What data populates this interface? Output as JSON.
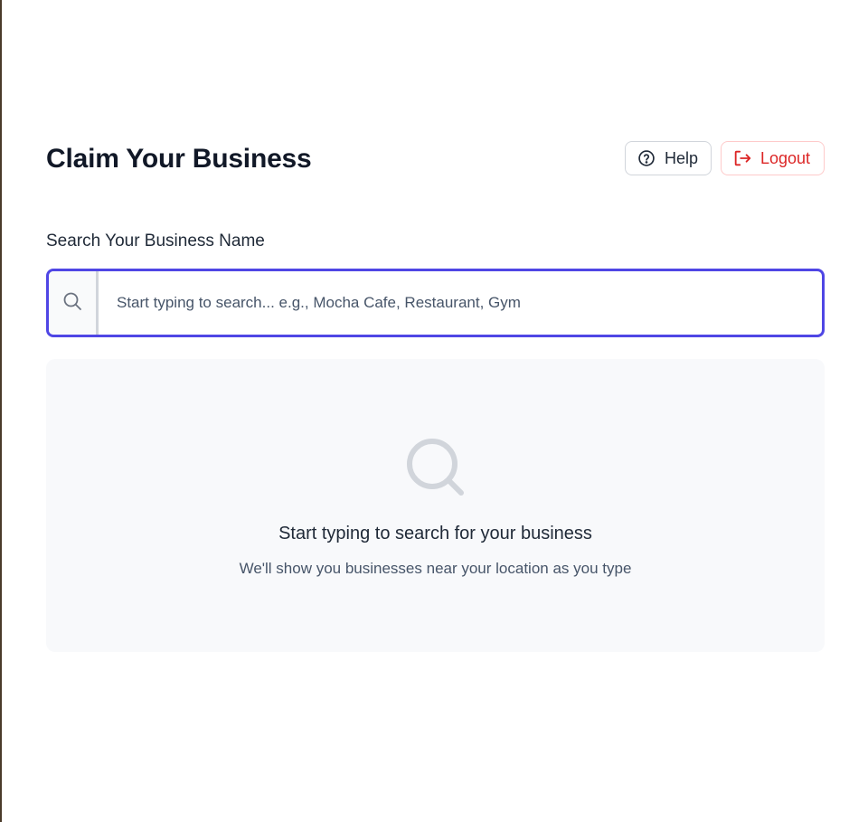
{
  "header": {
    "title": "Claim Your Business",
    "help_label": "Help",
    "logout_label": "Logout"
  },
  "search": {
    "label": "Search Your Business Name",
    "placeholder": "Start typing to search... e.g., Mocha Cafe, Restaurant, Gym",
    "value": ""
  },
  "empty_state": {
    "title": "Start typing to search for your business",
    "subtitle": "We'll show you businesses near your location as you type"
  },
  "icons": {
    "help": "question-circle-icon",
    "logout": "logout-icon",
    "search": "search-icon",
    "empty": "large-search-icon"
  },
  "colors": {
    "accent": "#4f46e5",
    "danger": "#dc2626",
    "danger_border": "#fecaca",
    "title": "#111827",
    "muted_text": "#475569",
    "panel_bg": "#f8f9fb"
  }
}
